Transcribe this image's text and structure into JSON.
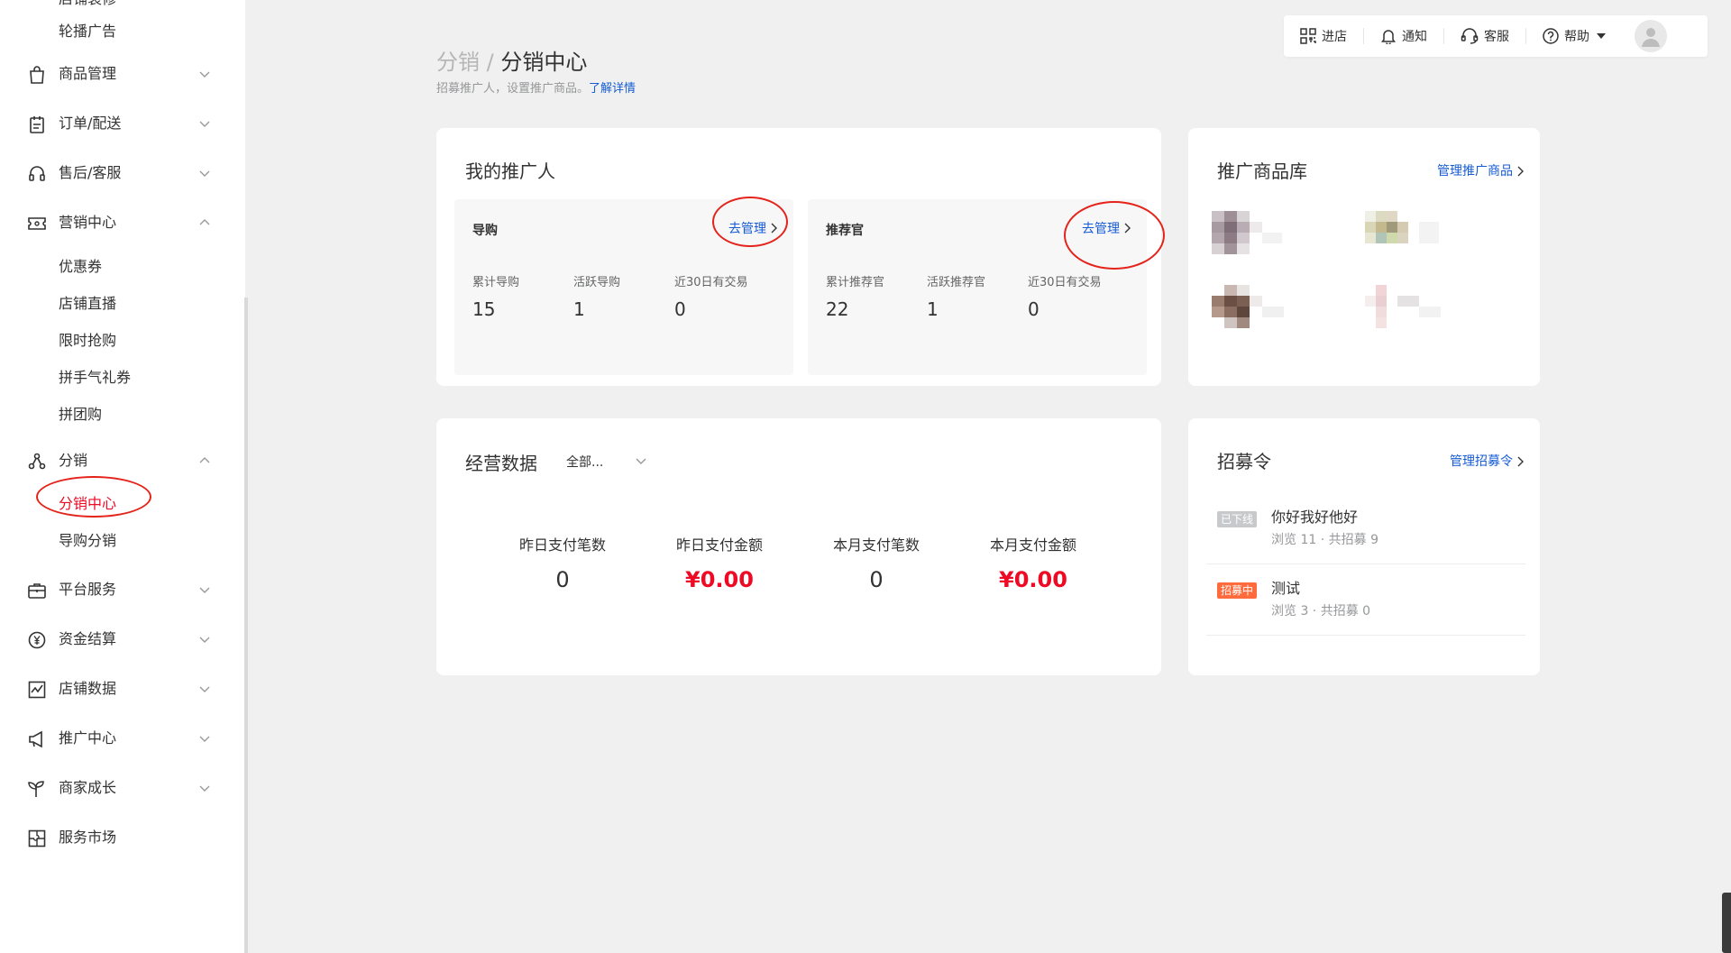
{
  "sidebar": {
    "top_partial_label": "店铺装修",
    "carousel_label": "轮播广告",
    "groups": [
      {
        "label": "商品管理",
        "icon": "shopping-bag-icon",
        "expanded": false
      },
      {
        "label": "订单/配送",
        "icon": "order-list-icon",
        "expanded": false
      },
      {
        "label": "售后/客服",
        "icon": "headset-icon",
        "expanded": false
      },
      {
        "label": "营销中心",
        "icon": "ticket-icon",
        "expanded": true
      },
      {
        "label": "分销",
        "icon": "distribution-icon",
        "expanded": true
      },
      {
        "label": "平台服务",
        "icon": "briefcase-icon",
        "expanded": false
      },
      {
        "label": "资金结算",
        "icon": "yuan-coin-icon",
        "expanded": false
      },
      {
        "label": "店铺数据",
        "icon": "chart-line-icon",
        "expanded": false
      },
      {
        "label": "推广中心",
        "icon": "megaphone-icon",
        "expanded": false
      },
      {
        "label": "商家成长",
        "icon": "sprout-icon",
        "expanded": false
      },
      {
        "label": "服务市场",
        "icon": "puzzle-icon",
        "expanded": false
      }
    ],
    "marketing_items": [
      "优惠券",
      "店铺直播",
      "限时抢购",
      "拼手气礼券",
      "拼团购"
    ],
    "distribution_items": [
      "分销中心",
      "导购分销"
    ],
    "active_item": "分销中心"
  },
  "topbar": {
    "store": "进店",
    "notify": "通知",
    "service": "客服",
    "help": "帮助"
  },
  "header": {
    "breadcrumb_parent": "分销",
    "breadcrumb_sep": "/",
    "title": "分销中心",
    "subtitle": "招募推广人，设置推广商品。",
    "learn_more": "了解详情"
  },
  "promoters": {
    "title": "我的推广人",
    "guide": {
      "title": "导购",
      "link": "去管理",
      "stats": [
        {
          "label": "累计导购",
          "value": "15"
        },
        {
          "label": "活跃导购",
          "value": "1"
        },
        {
          "label": "近30日有交易",
          "value": "0"
        }
      ]
    },
    "recommender": {
      "title": "推荐官",
      "link": "去管理",
      "stats": [
        {
          "label": "累计推荐官",
          "value": "22"
        },
        {
          "label": "活跃推荐官",
          "value": "1"
        },
        {
          "label": "近30日有交易",
          "value": "0"
        }
      ]
    }
  },
  "product_library": {
    "title": "推广商品库",
    "link": "管理推广商品"
  },
  "business": {
    "title": "经营数据",
    "filter": "全部...",
    "metrics": [
      {
        "label": "昨日支付笔数",
        "value": "0",
        "currency": false
      },
      {
        "label": "昨日支付金额",
        "value": "¥0.00",
        "currency": true
      },
      {
        "label": "本月支付笔数",
        "value": "0",
        "currency": false
      },
      {
        "label": "本月支付金额",
        "value": "¥0.00",
        "currency": true
      }
    ]
  },
  "recruit": {
    "title": "招募令",
    "link": "管理招募令",
    "items": [
      {
        "badge": "已下线",
        "badge_color": "#c8c9cc",
        "name": "你好我好他好",
        "meta": "浏览 11 · 共招募 9"
      },
      {
        "badge": "招募中",
        "badge_color": "#ff6b3d",
        "name": "测试",
        "meta": "浏览 3 · 共招募 0"
      }
    ]
  },
  "colors": {
    "accent_blue": "#155bd4",
    "active_red": "#ee0a24",
    "annotation_red": "#e4231a"
  }
}
